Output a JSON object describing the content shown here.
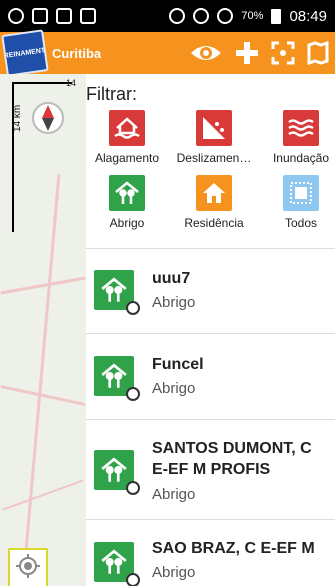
{
  "status_bar": {
    "battery": "70%",
    "time": "08:49"
  },
  "app": {
    "title": "Curitiba",
    "logo_text": "TREINAMENTO"
  },
  "map": {
    "scale_label": "14 km",
    "scale_top_label": "14"
  },
  "filter": {
    "title": "Filtrar:",
    "items": [
      {
        "label": "Alagamento",
        "icon": "flood-house-icon",
        "color": "#d83a3a"
      },
      {
        "label": "Deslizamen…",
        "icon": "landslide-icon",
        "color": "#d83a3a"
      },
      {
        "label": "Inundação",
        "icon": "waves-icon",
        "color": "#d83a3a"
      },
      {
        "label": "Abrigo",
        "icon": "shelter-icon",
        "color": "#2fa24a"
      },
      {
        "label": "Residência",
        "icon": "home-icon",
        "color": "#f5931e"
      },
      {
        "label": "Todos",
        "icon": "all-icon",
        "color": "#8ec7ef"
      }
    ]
  },
  "list": [
    {
      "title": "uuu7",
      "subtitle": "Abrigo"
    },
    {
      "title": "Funcel",
      "subtitle": "Abrigo"
    },
    {
      "title": "SANTOS DUMONT, C",
      "title2": "E-EF M PROFIS",
      "subtitle": "Abrigo"
    },
    {
      "title": "SAO BRAZ, C E-EF M",
      "subtitle": "Abrigo"
    }
  ],
  "colors": {
    "accent": "#f5931e",
    "shelter": "#2fa24a",
    "danger": "#d83a3a"
  }
}
